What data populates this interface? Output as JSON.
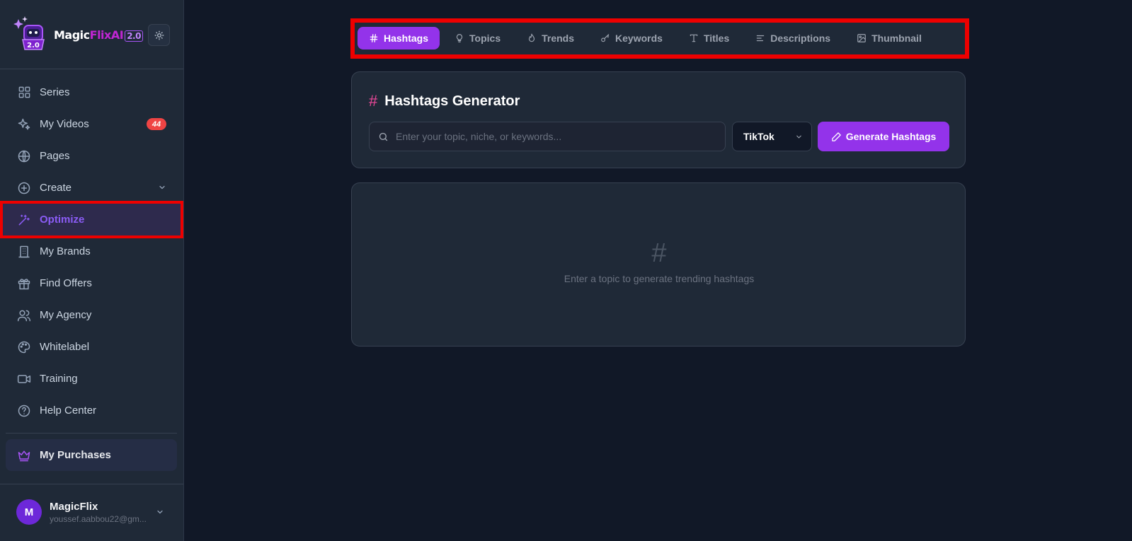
{
  "brand": {
    "name_prefix": "Magic",
    "name_accent": "FlixAI",
    "version": "2.0",
    "logo_badge": "2.0",
    "accent_color": "#9333ea"
  },
  "theme_toggle": {
    "icon": "sun-icon"
  },
  "sidebar": {
    "items": [
      {
        "label": "Series",
        "icon": "grid-icon"
      },
      {
        "label": "My Videos",
        "icon": "sparkles-icon",
        "badge": "44"
      },
      {
        "label": "Pages",
        "icon": "globe-icon"
      },
      {
        "label": "Create",
        "icon": "plus-circle-icon",
        "has_submenu": true
      },
      {
        "label": "Optimize",
        "icon": "magic-wand-icon",
        "active": true
      },
      {
        "label": "My Brands",
        "icon": "building-icon"
      },
      {
        "label": "Find Offers",
        "icon": "gift-icon"
      },
      {
        "label": "My Agency",
        "icon": "users-icon"
      },
      {
        "label": "Whitelabel",
        "icon": "palette-icon"
      },
      {
        "label": "Training",
        "icon": "video-icon"
      },
      {
        "label": "Help Center",
        "icon": "help-circle-icon"
      }
    ],
    "purchases": {
      "label": "My Purchases",
      "icon": "crown-icon"
    }
  },
  "user": {
    "initial": "M",
    "name": "MagicFlix",
    "email": "youssef.aabbou22@gm..."
  },
  "tabs": [
    {
      "label": "Hashtags",
      "icon": "hash-icon",
      "active": true
    },
    {
      "label": "Topics",
      "icon": "lightbulb-icon"
    },
    {
      "label": "Trends",
      "icon": "flame-icon"
    },
    {
      "label": "Keywords",
      "icon": "key-icon"
    },
    {
      "label": "Titles",
      "icon": "type-icon"
    },
    {
      "label": "Descriptions",
      "icon": "align-left-icon"
    },
    {
      "label": "Thumbnail",
      "icon": "image-icon"
    }
  ],
  "generator": {
    "title_icon": "#",
    "title": "Hashtags Generator",
    "search_placeholder": "Enter your topic, niche, or keywords...",
    "search_value": "",
    "platform": "TikTok",
    "button_label": "Generate Hashtags"
  },
  "empty_state": {
    "icon": "#",
    "text": "Enter a topic to generate trending hashtags"
  }
}
